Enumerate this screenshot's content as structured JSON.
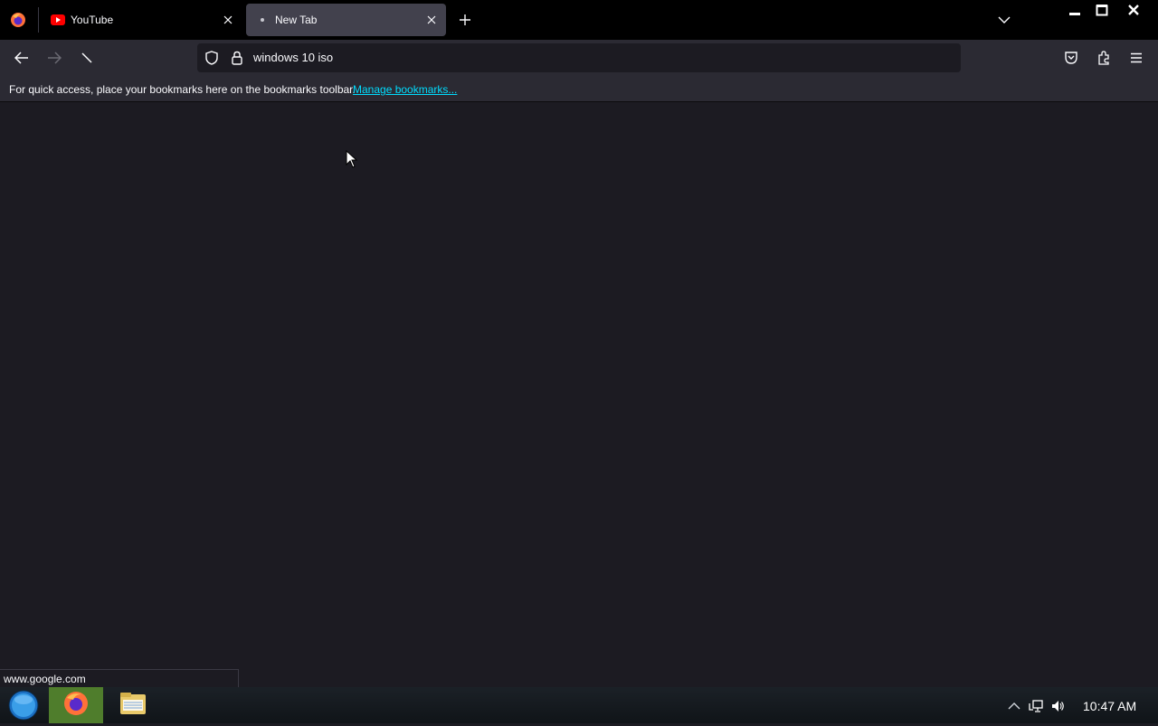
{
  "tabs": [
    {
      "title": "YouTube",
      "favicon": "youtube-icon",
      "active": false
    },
    {
      "title": "New Tab",
      "favicon": "loading-dot-icon",
      "active": true
    }
  ],
  "navbar": {
    "url": "windows 10 iso"
  },
  "bookmarks_toolbar": {
    "message": "For quick access, place your bookmarks here on the bookmarks toolbar.",
    "link": "Manage bookmarks..."
  },
  "status_bar": {
    "text": "www.google.com"
  },
  "taskbar": {
    "clock": "10:47 AM"
  },
  "colors": {
    "accent_link": "#00ddff",
    "toolbar_bg": "#2b2a33",
    "content_bg": "#1c1b22",
    "titlebar_bg": "#000000",
    "active_tab_bg": "#42414d"
  }
}
